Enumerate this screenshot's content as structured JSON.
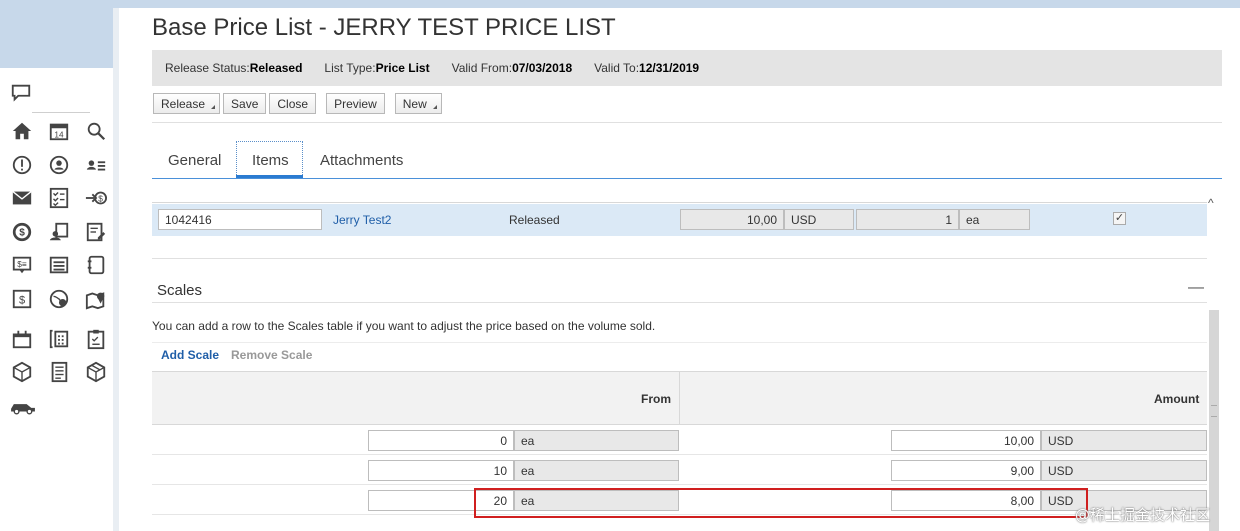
{
  "page": {
    "title": "Base Price List - JERRY TEST PRICE LIST"
  },
  "info": {
    "release_status_label": "Release Status:",
    "release_status_value": "Released",
    "list_type_label": "List Type:",
    "list_type_value": "Price List",
    "valid_from_label": "Valid From:",
    "valid_from_value": "07/03/2018",
    "valid_to_label": "Valid To:",
    "valid_to_value": "12/31/2019"
  },
  "toolbar": {
    "release_label": "Release",
    "save_label": "Save",
    "close_label": "Close",
    "preview_label": "Preview",
    "new_label": "New"
  },
  "tabs": [
    {
      "label": "General",
      "active": false
    },
    {
      "label": "Items",
      "active": true
    },
    {
      "label": "Attachments",
      "active": false
    }
  ],
  "item_row": {
    "product_id": "1042416",
    "description": "Jerry Test2",
    "status": "Released",
    "price": "10,00",
    "currency": "USD",
    "quantity": "1",
    "unit": "ea",
    "checked": "✓"
  },
  "scales": {
    "title": "Scales",
    "collapse_symbol": "—",
    "hint": "You can add a row to the Scales table if you want to adjust the price based on the volume sold.",
    "add_label": "Add Scale",
    "remove_label": "Remove Scale",
    "col_from": "From",
    "col_amount": "Amount",
    "rows": [
      {
        "from": "0",
        "from_unit": "ea",
        "amount": "10,00",
        "currency": "USD"
      },
      {
        "from": "10",
        "from_unit": "ea",
        "amount": "9,00",
        "currency": "USD"
      },
      {
        "from": "20",
        "from_unit": "ea",
        "amount": "8,00",
        "currency": "USD"
      }
    ]
  },
  "icons": {
    "sidebar": [
      "chat-bubble-icon",
      "home-icon",
      "calendar-icon",
      "search-icon",
      "alert-icon",
      "person-circle-icon",
      "contacts-list-icon",
      "mail-icon",
      "checklist-icon",
      "money-arrow-icon",
      "dollar-circle-icon",
      "team-card-icon",
      "edit-doc-icon",
      "price-tag-icon",
      "list-icon",
      "notebook-icon",
      "dollar-doc-icon",
      "globe-money-icon",
      "map-pin-icon",
      "briefcase-icon",
      "calculator-icon",
      "clipboard-icon",
      "box-icon",
      "document-icon",
      "package-icon",
      "car-icon"
    ],
    "scroll_up": "^"
  },
  "watermark": "@稀土掘金技术社区"
}
